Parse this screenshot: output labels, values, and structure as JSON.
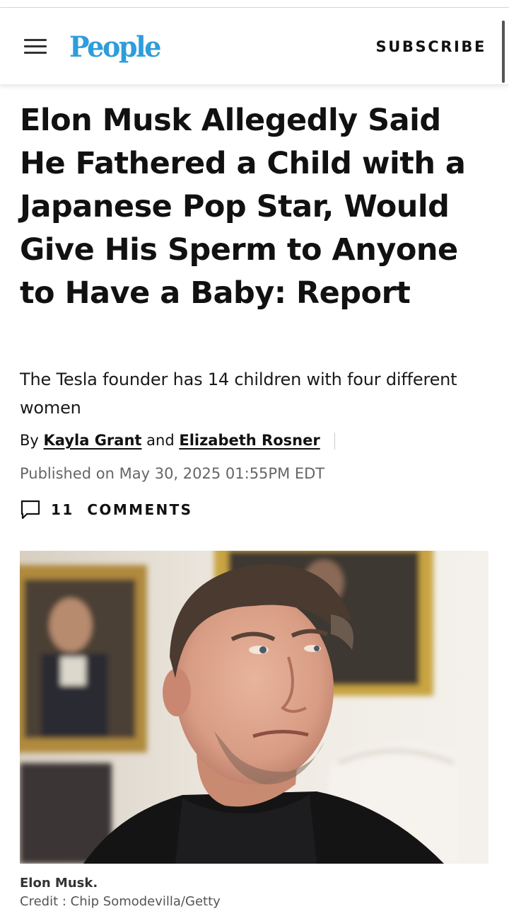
{
  "header": {
    "logo": "People",
    "subscribe_label": "SUBSCRIBE",
    "brand_color": "#2e9ddb"
  },
  "article": {
    "headline": "Elon Musk Allegedly Said He Fathered a Child with a Japanese Pop Star, Would Give His Sperm to Anyone to Have a Baby: Report",
    "subheadline": "The Tesla founder has 14 children with four different women",
    "byline": {
      "prefix": "By",
      "author1": "Kayla Grant",
      "conjunction": "and",
      "author2": "Elizabeth Rosner"
    },
    "published": "Published on May 30, 2025 01:55PM EDT",
    "comments_label": "11  COMMENTS"
  },
  "image": {
    "caption": "Elon Musk.",
    "credit": "Credit : Chip Somodevilla/Getty"
  },
  "icons": {
    "menu": "hamburger-menu-icon",
    "comments": "speech-bubble-icon"
  }
}
